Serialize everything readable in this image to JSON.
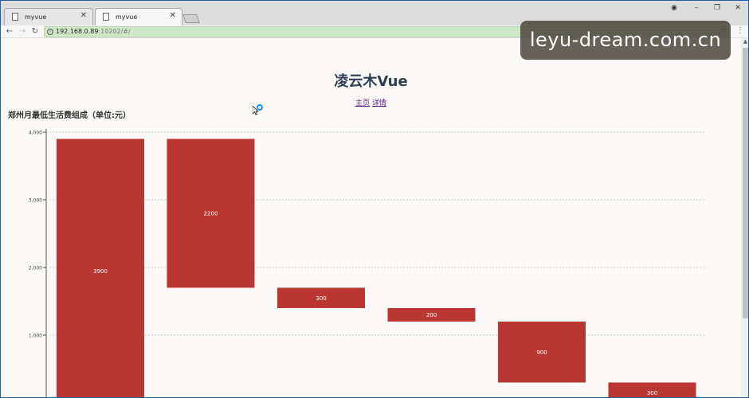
{
  "browser": {
    "tabs": [
      {
        "title": "myvue",
        "active": false
      },
      {
        "title": "myvue",
        "active": true
      }
    ],
    "url_host": "192.168.0.89",
    "url_rest": ":10202/#/"
  },
  "page": {
    "heading": "凌云木Vue",
    "nav": {
      "home": "主页",
      "detail": "详情"
    },
    "chart_title": "郑州月最低生活费组成（单位:元）"
  },
  "watermark": "leyu-dream.com.cn",
  "colors": {
    "bar": "#b93632",
    "background": "#fbf9f8",
    "grid": "#bbbbbb",
    "omnibox": "#cfe8c7"
  },
  "chart_data": {
    "type": "bar",
    "subtype": "waterfall",
    "title": "郑州月最低生活费组成（单位:元）",
    "y_ticks": [
      "1,000",
      "2,000",
      "3,000",
      "4,000"
    ],
    "ylim": [
      0,
      4000
    ],
    "grid": true,
    "bars": [
      {
        "label": "3900",
        "low": 0,
        "high": 3900
      },
      {
        "label": "2200",
        "low": 1700,
        "high": 3900
      },
      {
        "label": "300",
        "low": 1400,
        "high": 1700
      },
      {
        "label": "200",
        "low": 1200,
        "high": 1400
      },
      {
        "label": "900",
        "low": 300,
        "high": 1200
      },
      {
        "label": "300",
        "low": 0,
        "high": 300
      }
    ]
  }
}
